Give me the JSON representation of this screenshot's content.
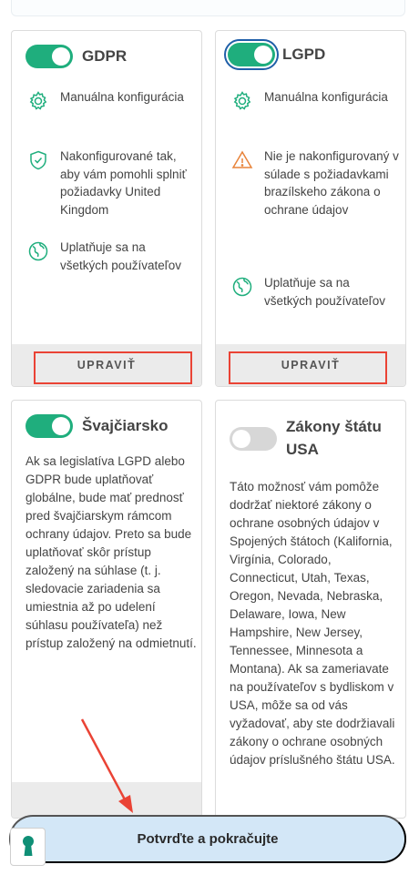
{
  "cards": {
    "gdpr": {
      "title": "GDPR",
      "enabled": true,
      "features": [
        {
          "icon": "gear-icon",
          "text": "Manuálna konfigurácia"
        },
        {
          "icon": "shield-check-icon",
          "text": "Nakonfigurované tak, aby vám pomohli splniť požiadavky United Kingdom"
        },
        {
          "icon": "globe-icon",
          "text": "Uplatňuje sa na všetkých používateľov"
        }
      ],
      "edit_label": "UPRAVIŤ"
    },
    "lgpd": {
      "title": "LGPD",
      "enabled": true,
      "features": [
        {
          "icon": "gear-icon",
          "text": "Manuálna konfigurácia"
        },
        {
          "icon": "warning-icon",
          "text": "Nie je nakonfigurovaný v súlade s požiadavkami brazílskeho zákona o ochrane údajov"
        },
        {
          "icon": "globe-icon",
          "text": "Uplatňuje sa na všetkých používateľov"
        }
      ],
      "edit_label": "UPRAVIŤ"
    },
    "swiss": {
      "title": "Švajčiarsko",
      "enabled": true,
      "description": "Ak sa legislatíva LGPD alebo GDPR bude uplatňovať globálne, bude mať prednosť pred švajčiarskym rámcom ochrany údajov. Preto sa bude uplatňovať skôr prístup založený na súhlase (t. j. sledovacie zariadenia sa umiestnia až po udelení súhlasu používateľa) než prístup založený na odmietnutí."
    },
    "usa": {
      "title": "Zákony štátu USA",
      "enabled": false,
      "description": "Táto možnosť vám pomôže dodržať niektoré zákony o ochrane osobných údajov v Spojených štátoch (Kalifornia, Virgínia, Colorado, Connecticut, Utah, Texas, Oregon, Nevada, Nebraska, Delaware, Iowa, New Hampshire, New Jersey, Tennessee, Minnesota a Montana). Ak sa zameriavate na používateľov s bydliskom v USA, môže sa od vás vyžadovať, aby ste dodržiavali zákony o ochrane osobných údajov príslušného štátu USA."
    }
  },
  "confirm_button": "Potvrďte a pokračujte",
  "colors": {
    "toggle_on": "#1fae7d",
    "toggle_off": "#d7d7d7",
    "focus_ring": "#1f5fa8",
    "annotation_red": "#ea4335",
    "warning_orange": "#e8833a",
    "confirm_bg": "#d3e7f7",
    "keyhole_teal": "#0f8f76"
  }
}
